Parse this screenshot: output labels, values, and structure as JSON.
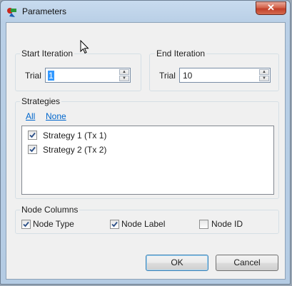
{
  "window": {
    "title": "Parameters",
    "close_glyph": "✕"
  },
  "start_iteration": {
    "title": "Start Iteration",
    "field_label": "Trial",
    "value": "1"
  },
  "end_iteration": {
    "title": "End Iteration",
    "field_label": "Trial",
    "value": "10"
  },
  "strategies": {
    "title": "Strategies",
    "all_link": "All",
    "none_link": "None",
    "items": [
      {
        "label": "Strategy 1 (Tx 1)",
        "checked": true
      },
      {
        "label": "Strategy 2 (Tx 2)",
        "checked": true
      }
    ]
  },
  "node_columns": {
    "title": "Node Columns",
    "items": [
      {
        "label": "Node Type",
        "checked": true
      },
      {
        "label": "Node Label",
        "checked": true
      },
      {
        "label": "Node ID",
        "checked": false
      }
    ]
  },
  "buttons": {
    "ok": "OK",
    "cancel": "Cancel"
  }
}
